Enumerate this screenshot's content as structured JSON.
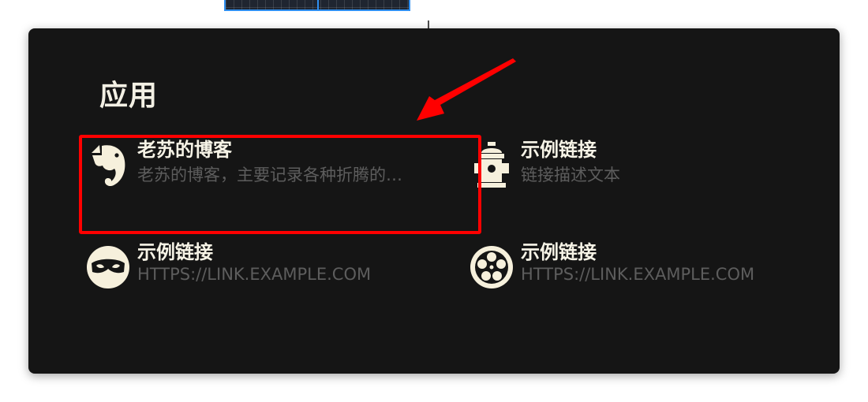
{
  "section": {
    "title": "应用"
  },
  "links": [
    {
      "name": "老苏的博客",
      "description": "老苏的博客，主要记录各种折腾的…",
      "icon": "evernote-elephant-icon"
    },
    {
      "name": "示例链接",
      "description": "链接描述文本",
      "icon": "fire-hydrant-icon"
    },
    {
      "name": "示例链接",
      "description": "HTTPS://LINK.EXAMPLE.COM",
      "icon": "mask-icon"
    },
    {
      "name": "示例链接",
      "description": "HTTPS://LINK.EXAMPLE.COM",
      "icon": "film-reel-icon"
    }
  ],
  "colors": {
    "card_background": "#151515",
    "title_text": "#f3f0e4",
    "description_text": "#5d5d5d",
    "icon_fill": "#f6f0dc",
    "highlight": "#ff0000",
    "selection_border": "#2f8ff0"
  }
}
